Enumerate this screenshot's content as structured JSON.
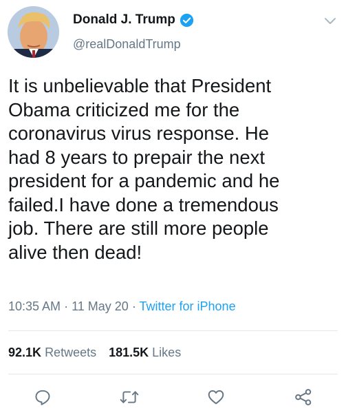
{
  "tweet": {
    "display_name": "Donald J. Trump",
    "handle": "@realDonaldTrump",
    "verified": true,
    "text": "It is unbelievable that President\nObama criticized me for the\ncoronavirus virus response. He\nhad 8 years to prepair the next\npresident for a pandemic and he\nfailed.I have done a tremendous\njob. There are still more people\nalive then dead!",
    "time": "10:35 AM",
    "date": "11 May 20",
    "separator": "·",
    "source": "Twitter for iPhone",
    "retweets_count": "92.1K",
    "retweets_label": "Retweets",
    "likes_count": "181.5K",
    "likes_label": "Likes"
  },
  "colors": {
    "text": "#14171a",
    "secondary": "#657786",
    "link": "#1da1f2",
    "divider": "#e1e8ed",
    "icon": "#657786"
  },
  "icons": {
    "verified": "verified-badge-icon",
    "menu": "chevron-down-icon",
    "reply": "reply-icon",
    "retweet": "retweet-icon",
    "like": "heart-icon",
    "share": "share-icon"
  }
}
